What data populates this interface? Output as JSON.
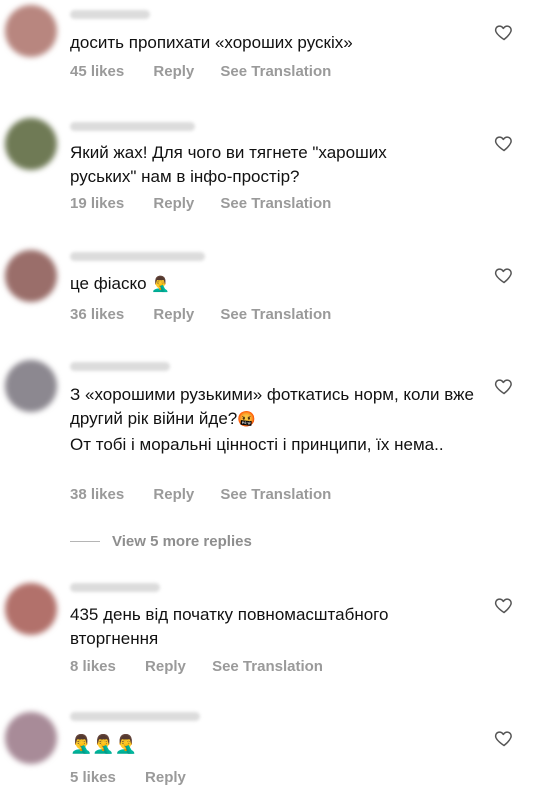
{
  "comments": [
    {
      "text": "досить пропихати «хороших рускіх»",
      "likes": "45 likes",
      "reply": "Reply",
      "translate": "See Translation"
    },
    {
      "text": "Який жах! Для чого ви тягнете \"хароших руських\" нам в інфо-простір?",
      "likes": "19 likes",
      "reply": "Reply",
      "translate": "See Translation"
    },
    {
      "text": "це фіаско",
      "emoji": "🤦‍♂️",
      "likes": "36 likes",
      "reply": "Reply",
      "translate": "See Translation"
    },
    {
      "text": "З «хорошими рузькими» фоткатись норм, коли вже другий рік війни йде?",
      "emoji": "🤬",
      "text2": "От тобі і моральні цінності і принципи, їх нема..",
      "likes": "38 likes",
      "reply": "Reply",
      "translate": "See Translation"
    },
    {
      "text": "435 день від початку повномасштабного вторгнення",
      "likes": "8 likes",
      "reply": "Reply",
      "translate": "See Translation"
    },
    {
      "emoji": "🤦‍♂️🤦‍♂️🤦‍♂️",
      "likes": "5 likes",
      "reply": "Reply"
    }
  ],
  "view_more": "View 5 more replies",
  "icons": {
    "like": "heart-outline-icon"
  },
  "colors": {
    "meta": "#9a9a9a",
    "text": "#111111"
  }
}
